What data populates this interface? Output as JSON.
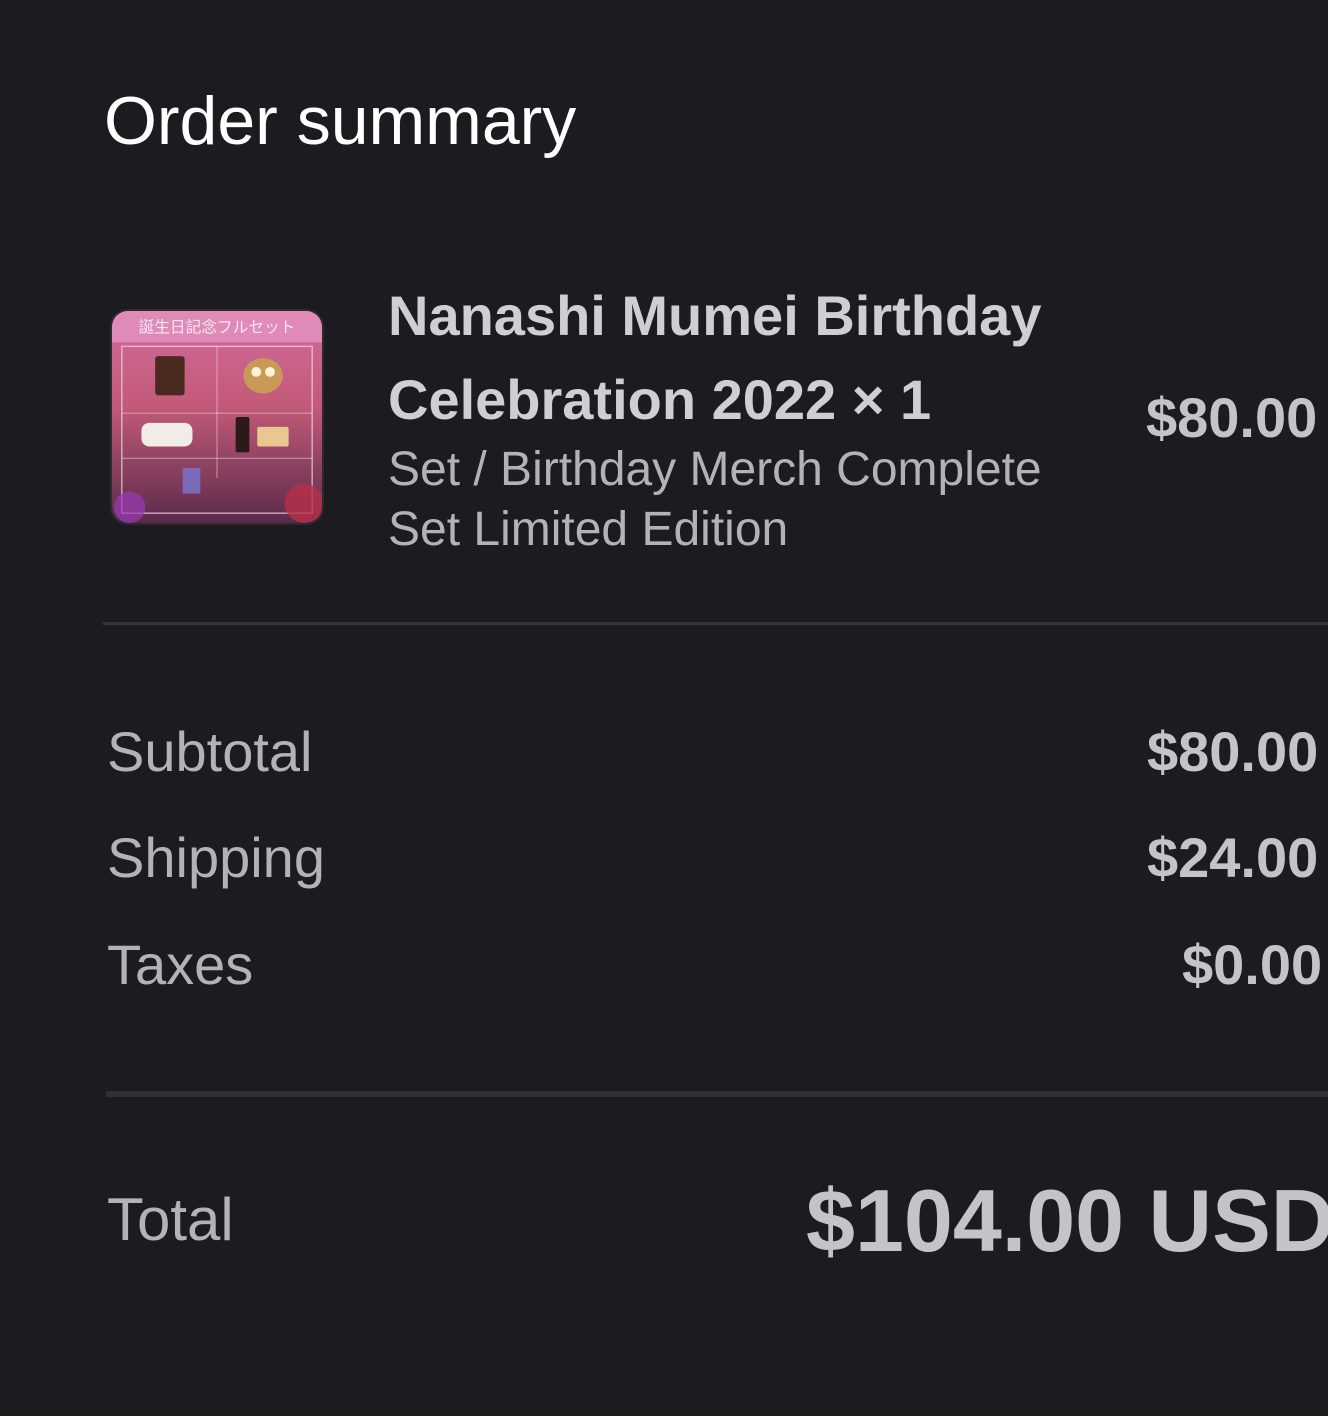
{
  "page": {
    "title": "Order summary"
  },
  "item": {
    "name": "Nanashi Mumei Birthday Celebration 2022 × 1",
    "variant": "Set / Birthday Merch Complete Set Limited Edition",
    "price": "$80.00",
    "thumbnail_banner": "誕生日記念フルセット"
  },
  "summary": {
    "subtotal_label": "Subtotal",
    "subtotal_value": "$80.00",
    "shipping_label": "Shipping",
    "shipping_value": "$24.00",
    "taxes_label": "Taxes",
    "taxes_value": "$0.00"
  },
  "total": {
    "label": "Total",
    "value": "$104.00 USD"
  },
  "colors": {
    "background": "#1c1c20",
    "title": "#ffffff",
    "muted_text": "#b3b3b7",
    "value_text": "#c4c4c7",
    "divider": "#34343a"
  }
}
